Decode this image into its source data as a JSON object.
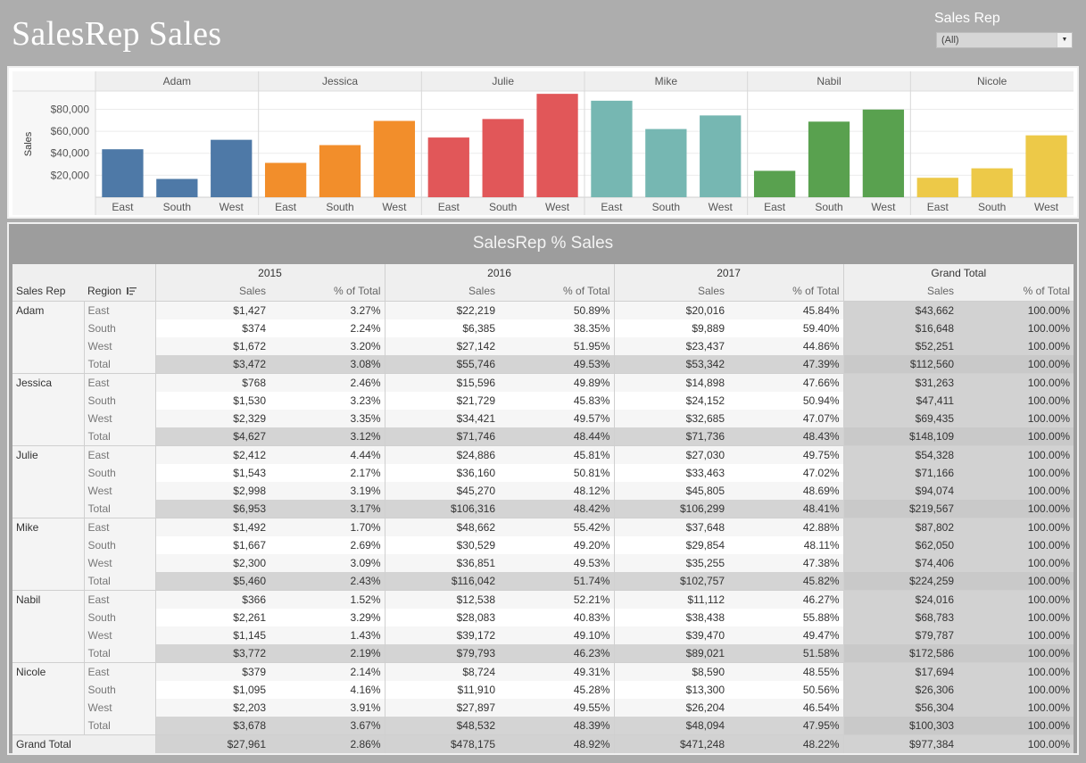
{
  "title": "SalesRep Sales",
  "filter": {
    "label": "Sales Rep",
    "value": "(All)"
  },
  "chart_data": {
    "type": "bar",
    "ylabel": "Sales",
    "ylim": [
      0,
      95000
    ],
    "yticks": [
      "$20,000",
      "$40,000",
      "$60,000",
      "$80,000"
    ],
    "ytick_values": [
      20000,
      40000,
      60000,
      80000
    ],
    "panels": [
      {
        "name": "Adam",
        "color": "#4e79a7",
        "categories": [
          "East",
          "South",
          "West"
        ],
        "values": [
          43662,
          16648,
          52251
        ]
      },
      {
        "name": "Jessica",
        "color": "#f28e2b",
        "categories": [
          "East",
          "South",
          "West"
        ],
        "values": [
          31263,
          47411,
          69435
        ]
      },
      {
        "name": "Julie",
        "color": "#e15759",
        "categories": [
          "East",
          "South",
          "West"
        ],
        "values": [
          54328,
          71166,
          94074
        ]
      },
      {
        "name": "Mike",
        "color": "#76b7b2",
        "categories": [
          "East",
          "South",
          "West"
        ],
        "values": [
          87802,
          62050,
          74406
        ]
      },
      {
        "name": "Nabil",
        "color": "#59a14f",
        "categories": [
          "East",
          "South",
          "West"
        ],
        "values": [
          24016,
          68783,
          79787
        ]
      },
      {
        "name": "Nicole",
        "color": "#edc948",
        "categories": [
          "East",
          "South",
          "West"
        ],
        "values": [
          17694,
          26306,
          56304
        ]
      }
    ]
  },
  "table": {
    "title": "SalesRep % Sales",
    "years": [
      "2015",
      "2016",
      "2017",
      "Grand Total"
    ],
    "row_headers": [
      "Sales Rep",
      "Region"
    ],
    "measures": [
      "Sales",
      "% of Total"
    ],
    "reps": [
      {
        "name": "Adam",
        "rows": [
          {
            "region": "East",
            "v": [
              "$1,427",
              "3.27%",
              "$22,219",
              "50.89%",
              "$20,016",
              "45.84%",
              "$43,662",
              "100.00%"
            ]
          },
          {
            "region": "South",
            "v": [
              "$374",
              "2.24%",
              "$6,385",
              "38.35%",
              "$9,889",
              "59.40%",
              "$16,648",
              "100.00%"
            ]
          },
          {
            "region": "West",
            "v": [
              "$1,672",
              "3.20%",
              "$27,142",
              "51.95%",
              "$23,437",
              "44.86%",
              "$52,251",
              "100.00%"
            ]
          },
          {
            "region": "Total",
            "v": [
              "$3,472",
              "3.08%",
              "$55,746",
              "49.53%",
              "$53,342",
              "47.39%",
              "$112,560",
              "100.00%"
            ]
          }
        ]
      },
      {
        "name": "Jessica",
        "rows": [
          {
            "region": "East",
            "v": [
              "$768",
              "2.46%",
              "$15,596",
              "49.89%",
              "$14,898",
              "47.66%",
              "$31,263",
              "100.00%"
            ]
          },
          {
            "region": "South",
            "v": [
              "$1,530",
              "3.23%",
              "$21,729",
              "45.83%",
              "$24,152",
              "50.94%",
              "$47,411",
              "100.00%"
            ]
          },
          {
            "region": "West",
            "v": [
              "$2,329",
              "3.35%",
              "$34,421",
              "49.57%",
              "$32,685",
              "47.07%",
              "$69,435",
              "100.00%"
            ]
          },
          {
            "region": "Total",
            "v": [
              "$4,627",
              "3.12%",
              "$71,746",
              "48.44%",
              "$71,736",
              "48.43%",
              "$148,109",
              "100.00%"
            ]
          }
        ]
      },
      {
        "name": "Julie",
        "rows": [
          {
            "region": "East",
            "v": [
              "$2,412",
              "4.44%",
              "$24,886",
              "45.81%",
              "$27,030",
              "49.75%",
              "$54,328",
              "100.00%"
            ]
          },
          {
            "region": "South",
            "v": [
              "$1,543",
              "2.17%",
              "$36,160",
              "50.81%",
              "$33,463",
              "47.02%",
              "$71,166",
              "100.00%"
            ]
          },
          {
            "region": "West",
            "v": [
              "$2,998",
              "3.19%",
              "$45,270",
              "48.12%",
              "$45,805",
              "48.69%",
              "$94,074",
              "100.00%"
            ]
          },
          {
            "region": "Total",
            "v": [
              "$6,953",
              "3.17%",
              "$106,316",
              "48.42%",
              "$106,299",
              "48.41%",
              "$219,567",
              "100.00%"
            ]
          }
        ]
      },
      {
        "name": "Mike",
        "rows": [
          {
            "region": "East",
            "v": [
              "$1,492",
              "1.70%",
              "$48,662",
              "55.42%",
              "$37,648",
              "42.88%",
              "$87,802",
              "100.00%"
            ]
          },
          {
            "region": "South",
            "v": [
              "$1,667",
              "2.69%",
              "$30,529",
              "49.20%",
              "$29,854",
              "48.11%",
              "$62,050",
              "100.00%"
            ]
          },
          {
            "region": "West",
            "v": [
              "$2,300",
              "3.09%",
              "$36,851",
              "49.53%",
              "$35,255",
              "47.38%",
              "$74,406",
              "100.00%"
            ]
          },
          {
            "region": "Total",
            "v": [
              "$5,460",
              "2.43%",
              "$116,042",
              "51.74%",
              "$102,757",
              "45.82%",
              "$224,259",
              "100.00%"
            ]
          }
        ]
      },
      {
        "name": "Nabil",
        "rows": [
          {
            "region": "East",
            "v": [
              "$366",
              "1.52%",
              "$12,538",
              "52.21%",
              "$11,112",
              "46.27%",
              "$24,016",
              "100.00%"
            ]
          },
          {
            "region": "South",
            "v": [
              "$2,261",
              "3.29%",
              "$28,083",
              "40.83%",
              "$38,438",
              "55.88%",
              "$68,783",
              "100.00%"
            ]
          },
          {
            "region": "West",
            "v": [
              "$1,145",
              "1.43%",
              "$39,172",
              "49.10%",
              "$39,470",
              "49.47%",
              "$79,787",
              "100.00%"
            ]
          },
          {
            "region": "Total",
            "v": [
              "$3,772",
              "2.19%",
              "$79,793",
              "46.23%",
              "$89,021",
              "51.58%",
              "$172,586",
              "100.00%"
            ]
          }
        ]
      },
      {
        "name": "Nicole",
        "rows": [
          {
            "region": "East",
            "v": [
              "$379",
              "2.14%",
              "$8,724",
              "49.31%",
              "$8,590",
              "48.55%",
              "$17,694",
              "100.00%"
            ]
          },
          {
            "region": "South",
            "v": [
              "$1,095",
              "4.16%",
              "$11,910",
              "45.28%",
              "$13,300",
              "50.56%",
              "$26,306",
              "100.00%"
            ]
          },
          {
            "region": "West",
            "v": [
              "$2,203",
              "3.91%",
              "$27,897",
              "49.55%",
              "$26,204",
              "46.54%",
              "$56,304",
              "100.00%"
            ]
          },
          {
            "region": "Total",
            "v": [
              "$3,678",
              "3.67%",
              "$48,532",
              "48.39%",
              "$48,094",
              "47.95%",
              "$100,303",
              "100.00%"
            ]
          }
        ]
      }
    ],
    "grand_total": {
      "label": "Grand Total",
      "v": [
        "$27,961",
        "2.86%",
        "$478,175",
        "48.92%",
        "$471,248",
        "48.22%",
        "$977,384",
        "100.00%"
      ]
    }
  }
}
